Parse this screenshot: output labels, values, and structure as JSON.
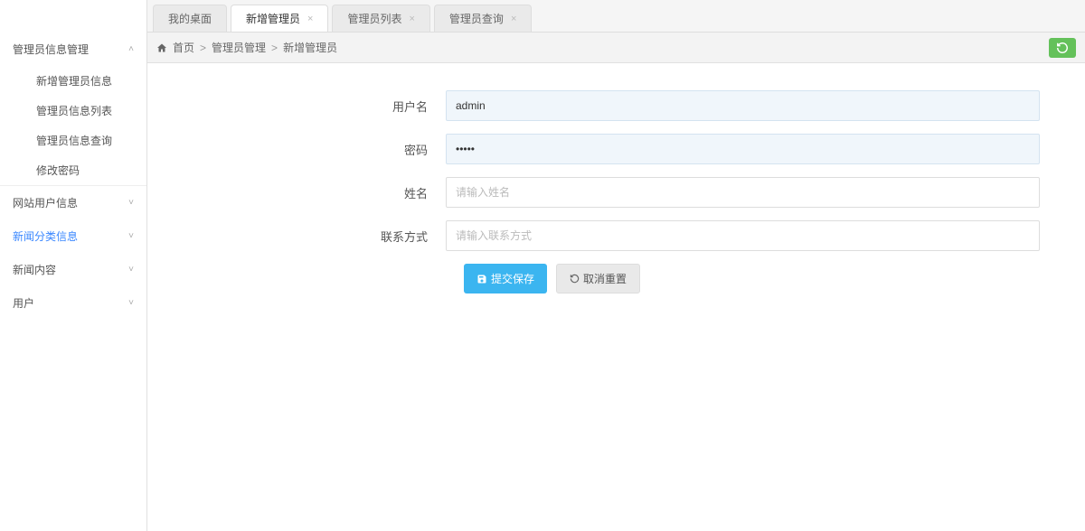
{
  "sidebar": {
    "groups": [
      {
        "label": "管理员信息管理",
        "expanded": true,
        "items": [
          {
            "label": "新增管理员信息"
          },
          {
            "label": "管理员信息列表"
          },
          {
            "label": "管理员信息查询"
          },
          {
            "label": "修改密码"
          }
        ]
      },
      {
        "label": "网站用户信息",
        "expanded": false
      },
      {
        "label": "新闻分类信息",
        "expanded": false,
        "active": true
      },
      {
        "label": "新闻内容",
        "expanded": false
      },
      {
        "label": "用户",
        "expanded": false
      }
    ]
  },
  "tabs": [
    {
      "label": "我的桌面",
      "closable": false
    },
    {
      "label": "新增管理员",
      "closable": true,
      "active": true
    },
    {
      "label": "管理员列表",
      "closable": true
    },
    {
      "label": "管理员查询",
      "closable": true
    }
  ],
  "breadcrumb": {
    "home": "首页",
    "sep": ">",
    "parts": [
      "管理员管理",
      "新增管理员"
    ]
  },
  "form": {
    "username": {
      "label": "用户名",
      "value": "admin"
    },
    "password": {
      "label": "密码",
      "value": "•••••"
    },
    "name": {
      "label": "姓名",
      "placeholder": "请输入姓名",
      "value": ""
    },
    "contact": {
      "label": "联系方式",
      "placeholder": "请输入联系方式",
      "value": ""
    }
  },
  "buttons": {
    "submit": "提交保存",
    "reset": "取消重置"
  }
}
